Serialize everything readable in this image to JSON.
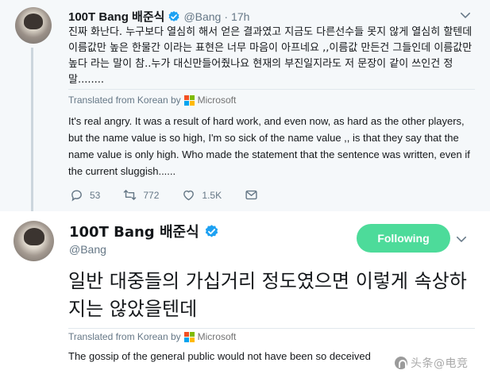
{
  "colors": {
    "verified": "#1da1f2",
    "follow_button": "#4ddb9a",
    "secondary_text": "#657786",
    "ms_red": "#f25022",
    "ms_green": "#7fba00",
    "ms_blue": "#00a4ef",
    "ms_yellow": "#ffb900"
  },
  "reply_tweet": {
    "display_name": "100T Bang 배준식",
    "handle": "@Bang",
    "dot": "·",
    "time": "17h",
    "korean_text": "진짜 화난다. 누구보다 열심히 해서 얻은 결과였고 지금도 다른선수들 못지 않게 열심히 할텐데 이름값만 높은 한물간 이라는 표현은 너무 마음이 아프네요 ,,이름값 만든건 그들인데 이름값만 높다 라는 말이 참..누가 대신만들어줬나요 현재의 부진일지라도 저 문장이 같이 쓰인건 정말........",
    "translated_label": "Translated from Korean by",
    "translator": "Microsoft",
    "english_text": "It's real angry. It was a result of hard work, and even now, as hard as the other players, but the name value is so high, I'm so sick of the name value ,, is that they say that the name value is only high. Who made the statement that the sentence was written, even if the current sluggish......",
    "reply_count": "53",
    "retweet_count": "772",
    "like_count": "1.5K",
    "icons": [
      "reply-icon",
      "retweet-icon",
      "like-icon",
      "message-icon",
      "chevron-down-icon",
      "verified-badge-icon"
    ]
  },
  "main_tweet": {
    "display_name": "100T Bang 배준식",
    "handle": "@Bang",
    "follow_label": "Following",
    "korean_text": "일반 대중들의 가십거리 정도였으면 이렇게 속상하지는 않았을텐데",
    "translated_label": "Translated from Korean by",
    "translator": "Microsoft",
    "english_text": "The gossip of the general public would not have been so deceived"
  },
  "watermark": {
    "text": "头条@电竞"
  }
}
